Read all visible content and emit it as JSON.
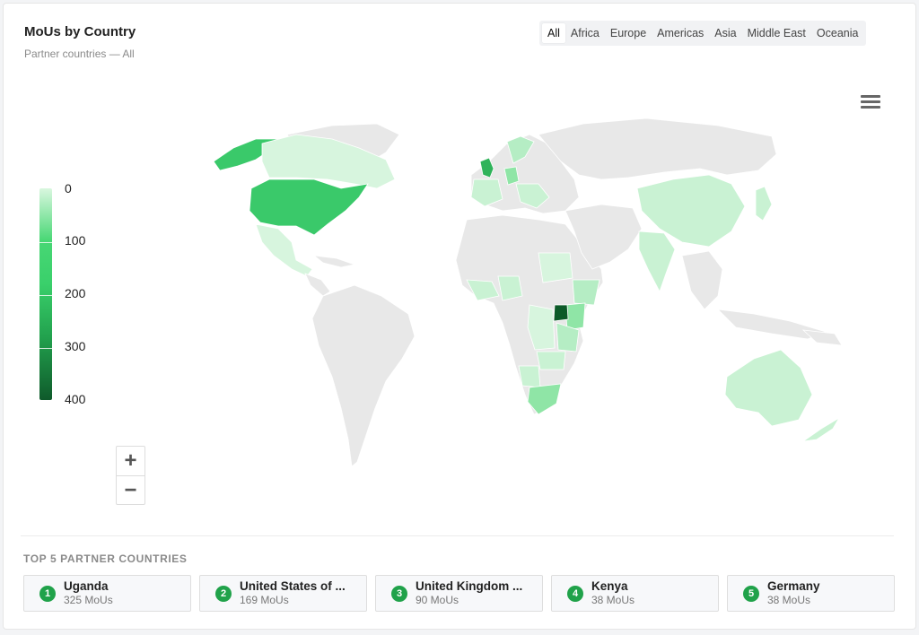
{
  "header": {
    "title": "MoUs by Country",
    "subtitle": "Partner countries — All"
  },
  "tabs": [
    {
      "label": "All",
      "active": true
    },
    {
      "label": "Africa",
      "active": false
    },
    {
      "label": "Europe",
      "active": false
    },
    {
      "label": "Americas",
      "active": false
    },
    {
      "label": "Asia",
      "active": false
    },
    {
      "label": "Middle East",
      "active": false
    },
    {
      "label": "Oceania",
      "active": false
    }
  ],
  "legend": {
    "labels": [
      "0",
      "100",
      "200",
      "300",
      "400"
    ],
    "min_color": "#d9f7df",
    "max_color": "#0f5a2b"
  },
  "zoom": {
    "in_icon": "+",
    "out_icon": "−"
  },
  "colors": {
    "no_data": "#e8e8e8",
    "low": "#c9f2d3",
    "mid": "#8fe5a6",
    "usa": "#3ac96a",
    "uk": "#2fb35a",
    "uganda": "#0c5a28",
    "accent": "#20a24a"
  },
  "top5": {
    "title": "TOP 5 PARTNER COUNTRIES",
    "items": [
      {
        "rank": "1",
        "name": "Uganda",
        "value": "325 MoUs"
      },
      {
        "rank": "2",
        "name": "United States of ...",
        "value": "169 MoUs"
      },
      {
        "rank": "3",
        "name": "United Kingdom ...",
        "value": "90 MoUs"
      },
      {
        "rank": "4",
        "name": "Kenya",
        "value": "38 MoUs"
      },
      {
        "rank": "5",
        "name": "Germany",
        "value": "38 MoUs"
      }
    ]
  }
}
